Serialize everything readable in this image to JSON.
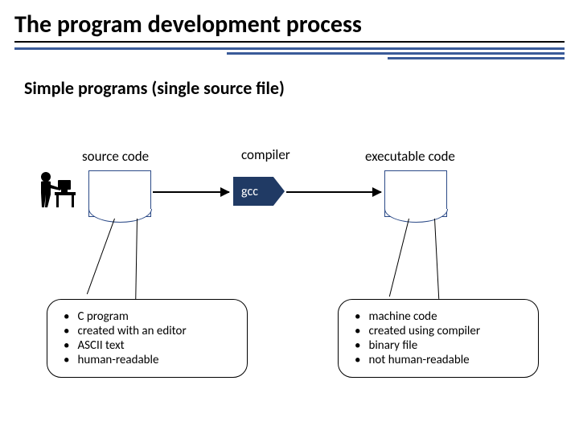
{
  "title": "The program development process",
  "subtitle": "Simple programs (single source file)",
  "headings": {
    "source": "source code",
    "compiler": "compiler",
    "executable": "executable code"
  },
  "compiler_name": "gcc",
  "callout_left": {
    "items": [
      "C program",
      "created with an editor",
      "ASCII text",
      "human-readable"
    ]
  },
  "callout_right": {
    "items": [
      "machine code",
      "created using compiler",
      "binary file",
      "not human-readable"
    ]
  }
}
